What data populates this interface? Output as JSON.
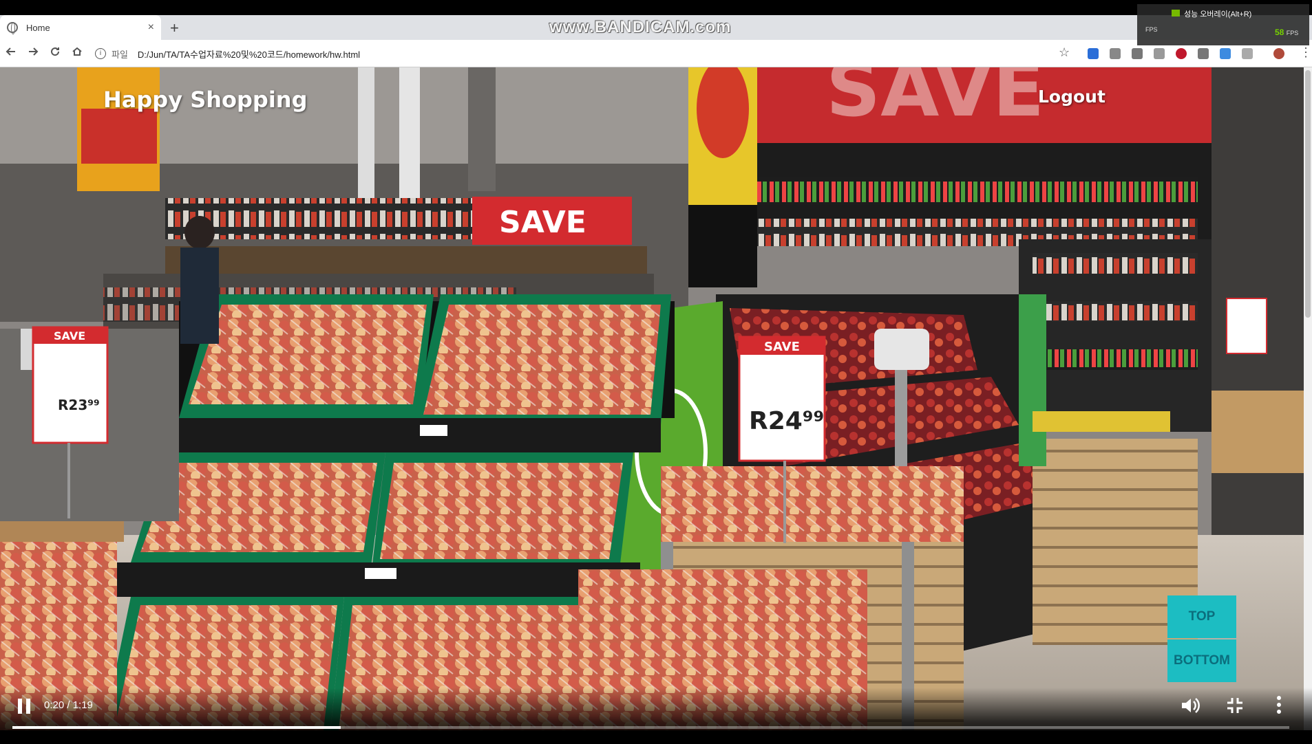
{
  "browser": {
    "tab_title": "Home",
    "tab_close": "×",
    "new_tab": "+",
    "scheme_label": "파일",
    "url": "D:/Jun/TA/TA수업자료%20및%20코드/homework/hw.html"
  },
  "watermark": "www.BANDICAM.com",
  "overlay": {
    "performance_label": "성능 오버레이(Alt+R)",
    "fps_label": "FPS",
    "fps_value": "58",
    "fps_unit": "FPS"
  },
  "page": {
    "brand": "Happy Shopping",
    "logout": "Logout",
    "scroll_top": "TOP",
    "scroll_bottom": "BOTTOM",
    "photo_signs": {
      "save_banner": "SAVE",
      "save_tag_left": "SAVE",
      "price_left": "R23⁹⁹",
      "save_tag_center": "SAVE",
      "price_center": "R24⁹⁹",
      "save_big": "SAVE"
    }
  },
  "video": {
    "time": "0:20 / 1:19",
    "progress": 0.257
  }
}
